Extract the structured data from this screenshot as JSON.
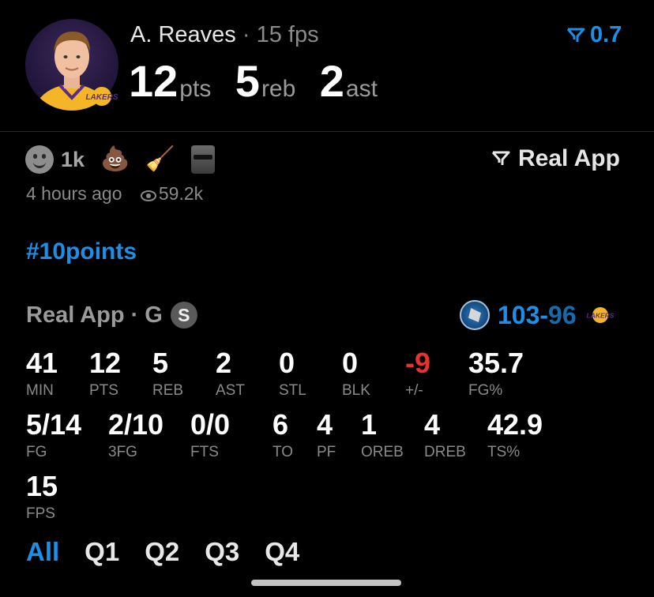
{
  "header": {
    "player_name": "A. Reaves",
    "separator": "·",
    "fps_label": "15 fps",
    "pts_value": "12",
    "pts_unit": "pts",
    "reb_value": "5",
    "reb_unit": "reb",
    "ast_value": "2",
    "ast_unit": "ast",
    "filter_score": "0.7",
    "accent_color": "#1e8fe6"
  },
  "post": {
    "reaction_count": "1k",
    "reaction_emojis": [
      "💩",
      "🧹"
    ],
    "source_label": "Real App",
    "time_ago": "4 hours ago",
    "views": "59.2k",
    "hashtag": "#10points"
  },
  "game": {
    "source": "Real App",
    "dot": "·",
    "position": "G",
    "badge": "S",
    "score_home": "103",
    "score_sep": "-",
    "score_away": "96"
  },
  "stats": {
    "row1": [
      {
        "value": "41",
        "label": "MIN"
      },
      {
        "value": "12",
        "label": "PTS"
      },
      {
        "value": "5",
        "label": "REB"
      },
      {
        "value": "2",
        "label": "AST"
      },
      {
        "value": "0",
        "label": "STL"
      },
      {
        "value": "0",
        "label": "BLK"
      },
      {
        "value": "-9",
        "label": "+/-"
      },
      {
        "value": "35.7",
        "label": "FG%"
      }
    ],
    "row2": [
      {
        "value": "5/14",
        "label": "FG"
      },
      {
        "value": "2/10",
        "label": "3FG"
      },
      {
        "value": "0/0",
        "label": "FTS"
      },
      {
        "value": "6",
        "label": "TO"
      },
      {
        "value": "4",
        "label": "PF"
      },
      {
        "value": "1",
        "label": "OREB"
      },
      {
        "value": "4",
        "label": "DREB"
      },
      {
        "value": "42.9",
        "label": "TS%"
      }
    ],
    "row3": [
      {
        "value": "15",
        "label": "FPS"
      }
    ]
  },
  "tabs": [
    "All",
    "Q1",
    "Q2",
    "Q3",
    "Q4"
  ],
  "negative_color": "#e8322e"
}
